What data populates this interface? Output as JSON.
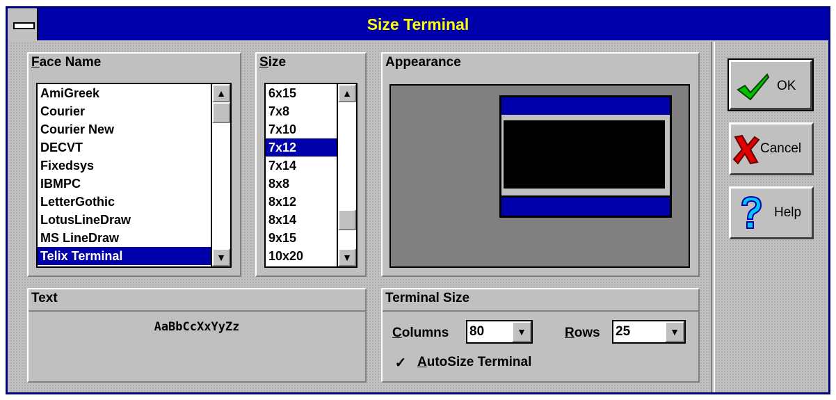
{
  "window": {
    "title": "Size Terminal"
  },
  "face_name": {
    "label": "Face Name",
    "items": [
      "AmiGreek",
      "Courier",
      "Courier New",
      "DECVT",
      "Fixedsys",
      "IBMPC",
      "LetterGothic",
      "LotusLineDraw",
      "MS LineDraw",
      "Telix Terminal"
    ],
    "selected": "Telix Terminal"
  },
  "size": {
    "label": "Size",
    "items": [
      "6x15",
      "7x8",
      "7x10",
      "7x12",
      "7x14",
      "8x8",
      "8x12",
      "8x14",
      "9x15",
      "10x20"
    ],
    "selected": "7x12"
  },
  "appearance": {
    "label": "Appearance"
  },
  "text": {
    "label": "Text",
    "sample": "AaBbCcXxYyZz"
  },
  "terminal_size": {
    "label": "Terminal Size",
    "columns_label": "Columns",
    "columns_value": "80",
    "rows_label": "Rows",
    "rows_value": "25",
    "autosize_label": "AutoSize Terminal",
    "autosize_checked": true
  },
  "buttons": {
    "ok": "OK",
    "cancel": "Cancel",
    "help": "Help"
  },
  "colors": {
    "title_bar": "#0000aa",
    "title_text": "#ffff00",
    "selection": "#0000aa",
    "face": "#c0c0c0"
  },
  "icons": {
    "ok": "checkmark-icon",
    "cancel": "red-x-icon",
    "help": "question-mark-icon"
  }
}
